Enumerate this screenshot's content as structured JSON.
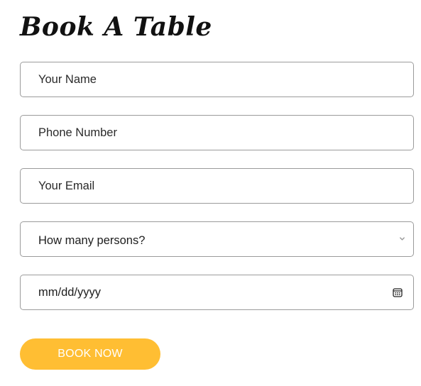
{
  "form": {
    "title": "Book A Table",
    "fields": {
      "name": {
        "placeholder": "Your Name"
      },
      "phone": {
        "placeholder": "Phone Number"
      },
      "email": {
        "placeholder": "Your Email"
      },
      "persons": {
        "selected": "How many persons?"
      },
      "date": {
        "placeholder": "mm/dd/yyyy"
      }
    },
    "submit_label": "BOOK NOW"
  },
  "colors": {
    "accent": "#ffbe33",
    "border": "#9b9b9b",
    "text": "#222222"
  },
  "icons": {
    "select": "chevron-down-icon",
    "date": "calendar-icon"
  }
}
